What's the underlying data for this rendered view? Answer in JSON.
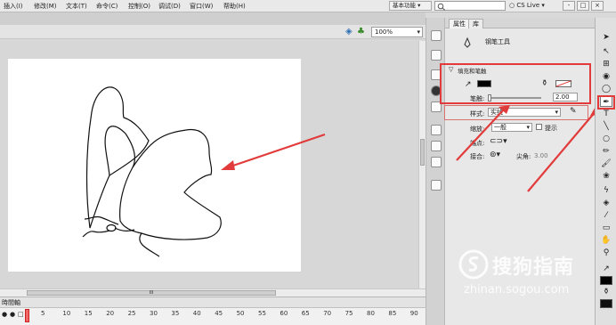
{
  "menu": [
    "插入(I)",
    "修改(M)",
    "文本(T)",
    "命令(C)",
    "控制(O)",
    "调试(D)",
    "窗口(W)",
    "帮助(H)"
  ],
  "workspace": "基本功能",
  "cs_live": "CS Live",
  "window_controls": [
    "-",
    "□",
    "×"
  ],
  "stage": {
    "zoom": "100%"
  },
  "timeline": {
    "panel_label": "時間軸",
    "frame_ticks": [
      "5",
      "10",
      "15",
      "20",
      "25",
      "30",
      "35",
      "40",
      "45",
      "50",
      "55",
      "60",
      "65",
      "70",
      "75",
      "80",
      "85",
      "90"
    ],
    "hscroll_grip": "III"
  },
  "properties": {
    "tabs": [
      "属性",
      "库"
    ],
    "tool_name": "钢笔工具",
    "section": "填充和笔触",
    "stroke_label": "笔触:",
    "stroke_value": "2.00",
    "style_label": "样式:",
    "style_value": "实线",
    "scale_label": "缩放:",
    "scale_value": "一般",
    "hint_label": "提示",
    "cap_label": "端点:",
    "join_label": "接合:",
    "miter_label": "尖角:",
    "miter_value": "3.00"
  },
  "watermark": {
    "brand": "搜狗指南",
    "url": "zhinan.sogou.com"
  },
  "colors": {
    "annotation": "#e23b3b",
    "stroke_swatch": "#000000"
  }
}
